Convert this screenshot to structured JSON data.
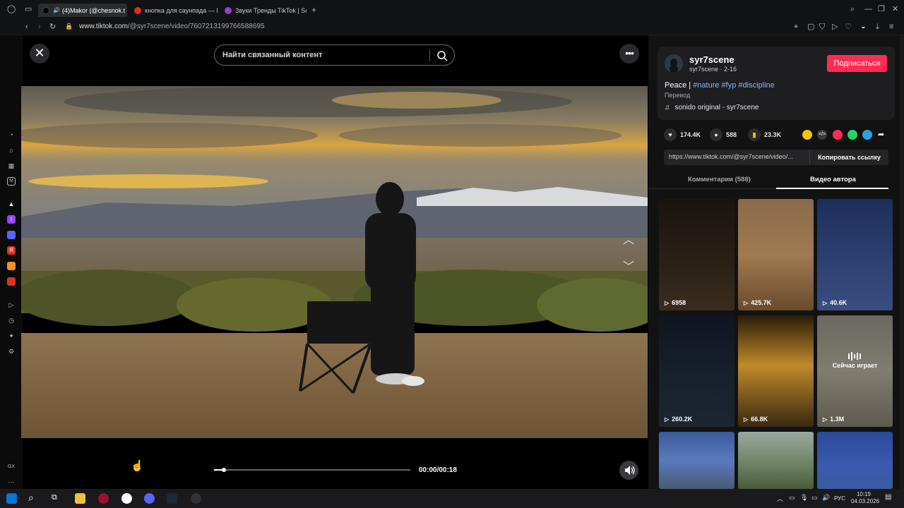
{
  "browser": {
    "tabs": [
      {
        "label": "(4)Makor (@chesnok.t",
        "active": true,
        "favicon_color": "#111111"
      },
      {
        "label": "кнопка для саунпада — Р",
        "active": false,
        "favicon_color": "#e0301e"
      },
      {
        "label": "Звуки Тренды TikTok | So",
        "active": false,
        "favicon_color": "#9b3cc9"
      }
    ],
    "url_host": "www.tiktok.com",
    "url_path": "/@syr7scene/video/7607213199766588695"
  },
  "search": {
    "placeholder": "Найти связанный контент"
  },
  "player": {
    "time": "00:00/00:18",
    "progress": 0.05
  },
  "author": {
    "name": "syr7scene",
    "sub": "syr7scene · 2-16",
    "follow_label": "Подписаться"
  },
  "caption": {
    "text": "Peace | ",
    "tags": "#nature #fyp #discipline",
    "translate": "Перевод",
    "music": "sonido original - syr7scene"
  },
  "stats": {
    "likes": "174.4K",
    "comments": "588",
    "saves": "23.3K"
  },
  "share": {
    "link": "https://www.tiktok.com/@syr7scene/video/...",
    "copy_label": "Копировать ссылку"
  },
  "panel_tabs": {
    "comments": "Комментарии (588)",
    "videos": "Видео автора"
  },
  "thumbnails": [
    {
      "views": "6958"
    },
    {
      "views": "425.7K"
    },
    {
      "views": "40.6K"
    },
    {
      "views": "260.2K"
    },
    {
      "views": "66.8K"
    },
    {
      "views": "1.3M",
      "now_playing": "Сейчас играет"
    },
    {
      "views": ""
    },
    {
      "views": ""
    },
    {
      "views": ""
    }
  ],
  "taskbar": {
    "lang": "РУС",
    "time": "10:19",
    "date": "04.03.2026"
  },
  "sidebar": {
    "gx_label": "GX"
  },
  "colors": {
    "accent": "#fe2c55",
    "hashtag": "#8ab4ff"
  }
}
